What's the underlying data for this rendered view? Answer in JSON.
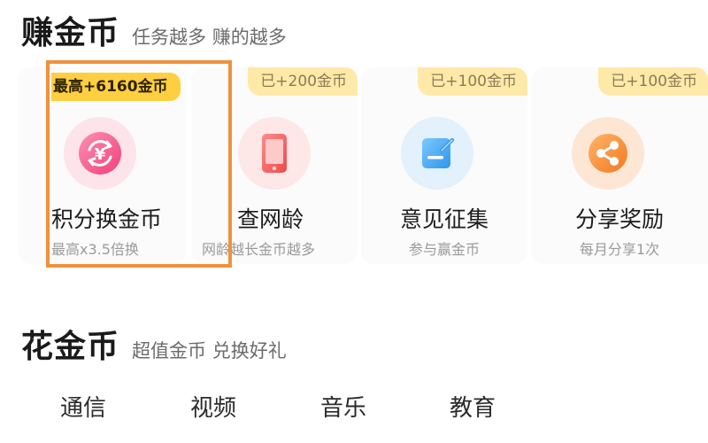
{
  "earn": {
    "title": "赚金币",
    "subtitle": "任务越多 赚的越多"
  },
  "tasks": [
    {
      "badge": "最高+6160金币",
      "title": "积分换金币",
      "desc": "最高x3.5倍换",
      "icon": "coin-exchange-icon",
      "color": "#f24f86"
    },
    {
      "badge": "已+200金币",
      "title": "查网龄",
      "desc": "网龄越长金币越多",
      "icon": "phone-icon",
      "color": "#f26060"
    },
    {
      "badge": "已+100金币",
      "title": "意见征集",
      "desc": "参与赢金币",
      "icon": "feedback-edit-icon",
      "color": "#3aa3ef"
    },
    {
      "badge": "已+100金币",
      "title": "分享奖励",
      "desc": "每月分享1次",
      "icon": "share-icon",
      "color": "#f48a2c"
    }
  ],
  "spend": {
    "title": "花金币",
    "subtitle": "超值金币 兑换好礼"
  },
  "categories": [
    "通信",
    "视频",
    "音乐",
    "教育"
  ],
  "highlight_color": "#f0913c"
}
